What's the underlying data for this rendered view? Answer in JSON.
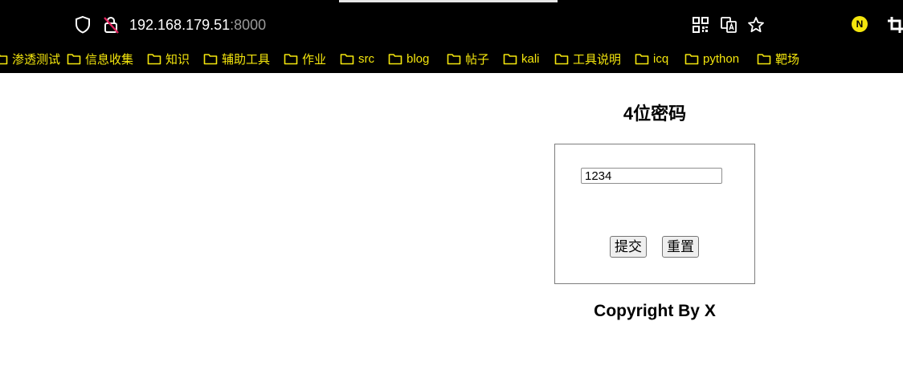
{
  "browser": {
    "url_host": "192.168.179.51",
    "url_port": ":8000",
    "profile_initial": "N",
    "bookmarks": [
      {
        "label": "渗透测试"
      },
      {
        "label": "信息收集"
      },
      {
        "label": "知识"
      },
      {
        "label": "辅助工具"
      },
      {
        "label": "作业"
      },
      {
        "label": "src"
      },
      {
        "label": "blog"
      },
      {
        "label": "帖子"
      },
      {
        "label": "kali"
      },
      {
        "label": "工具说明"
      },
      {
        "label": "icq"
      },
      {
        "label": "python"
      },
      {
        "label": "靶场"
      }
    ]
  },
  "page": {
    "title": "4位密码",
    "password_value": "1234",
    "submit_label": "提交",
    "reset_label": "重置",
    "footer": "Copyright By X"
  },
  "colors": {
    "chrome_bg": "#000000",
    "bookmark_text": "#f4e60d",
    "url_text": "#ffffff",
    "port_text": "#9a9a9a"
  }
}
